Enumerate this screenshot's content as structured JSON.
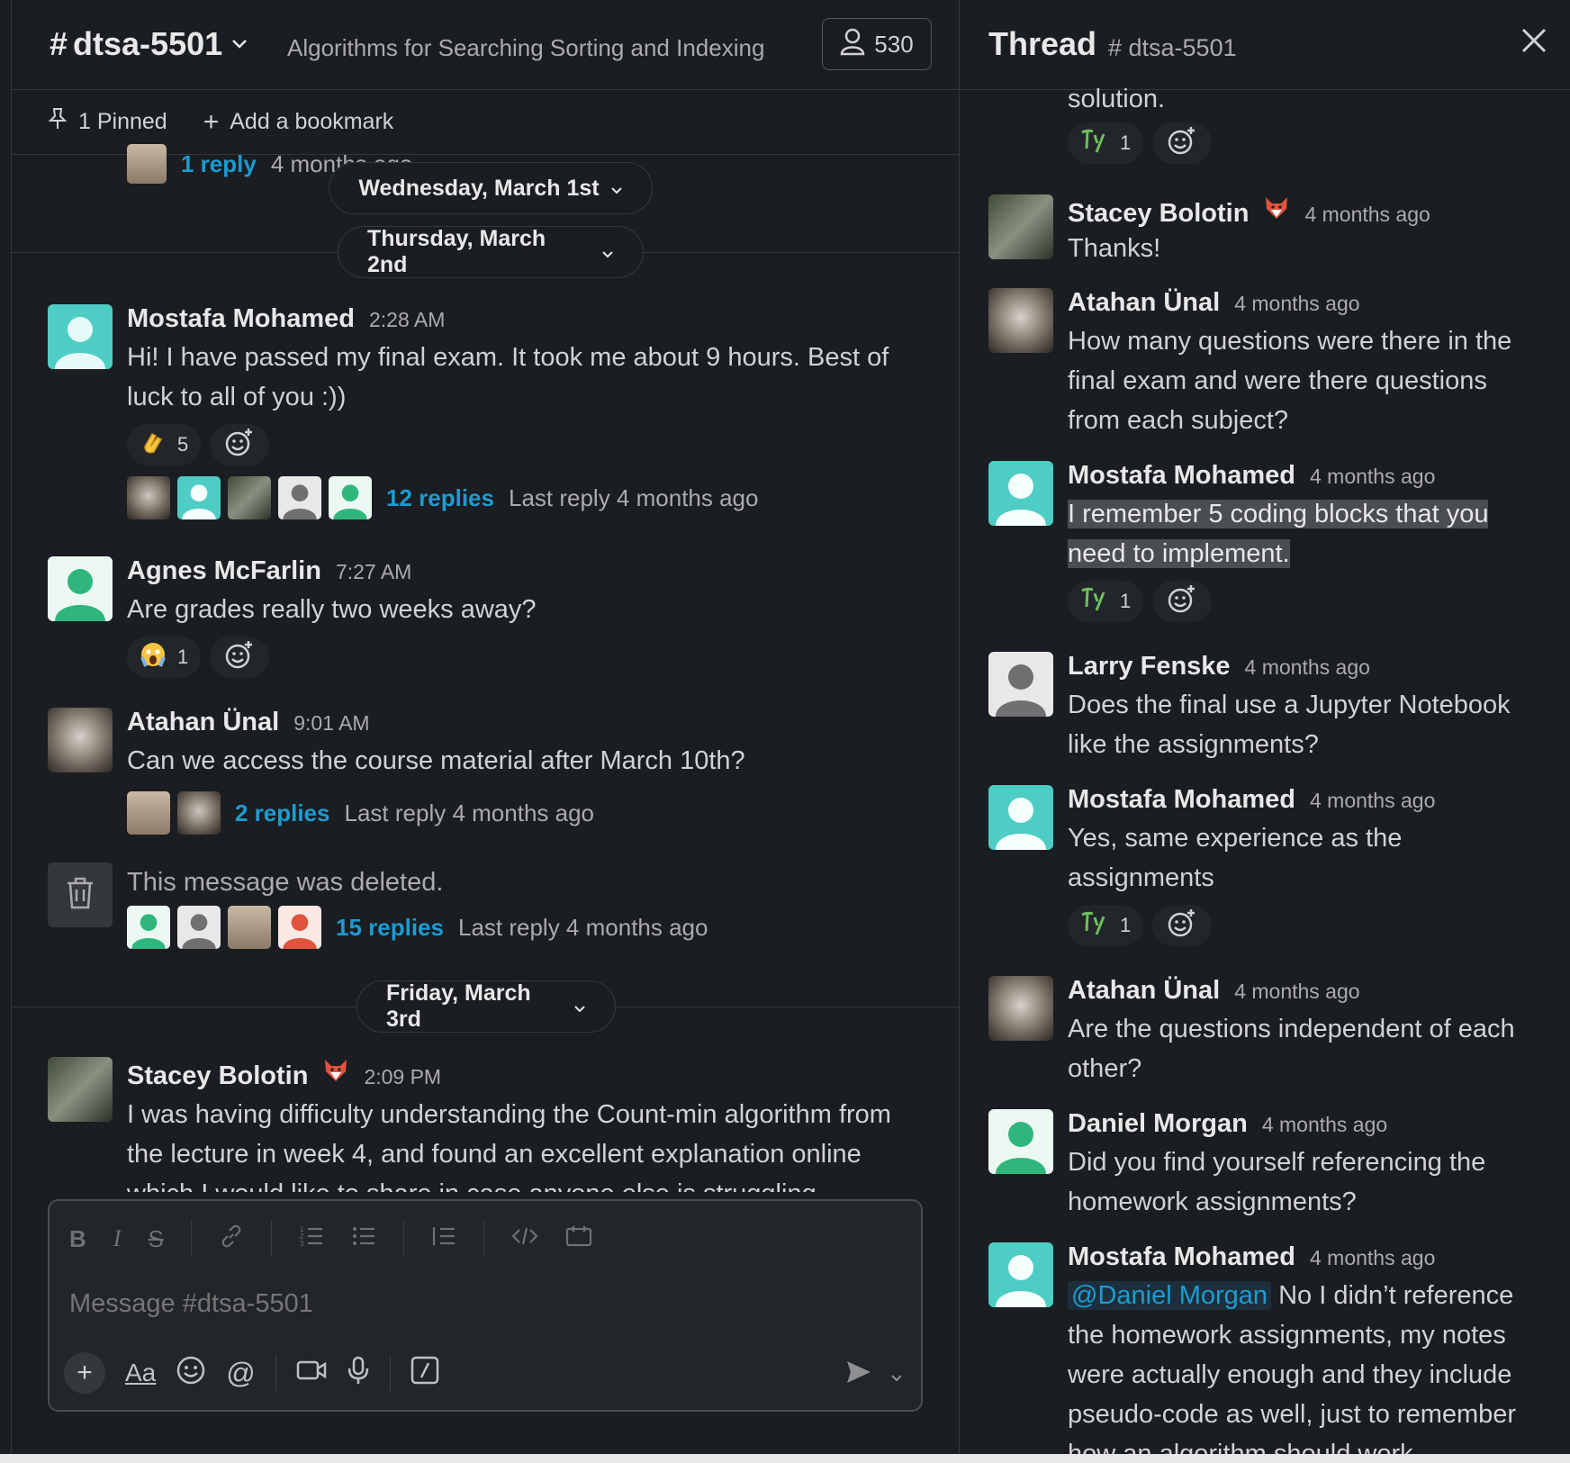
{
  "channel": {
    "hash": "#",
    "name": "dtsa-5501",
    "topic": "Algorithms for Searching Sorting and Indexing",
    "member_count": "530",
    "pinned_label": "1 Pinned",
    "bookmark_label": "Add a bookmark"
  },
  "top_partial": {
    "reply_link": "1 reply",
    "reply_last": "4 months ago"
  },
  "dates": {
    "d1": "Wednesday, March 1st",
    "d2": "Thursday, March 2nd",
    "d3": "Friday, March 3rd"
  },
  "messages": [
    {
      "author": "Mostafa Mohamed",
      "time": "2:28 AM",
      "text": "Hi! I have passed my final exam. It took me about 9 hours. Best of luck to all of you :))",
      "reaction_count": "5",
      "reply_link": "12 replies",
      "reply_last": "Last reply 4 months ago"
    },
    {
      "author": "Agnes McFarlin",
      "time": "7:27 AM",
      "text": "Are grades really two weeks away?",
      "reaction_count": "1"
    },
    {
      "author": "Atahan Ünal",
      "time": "9:01 AM",
      "text": "Can we access the course material after March 10th?",
      "reply_link": "2 replies",
      "reply_last": "Last reply 4 months ago"
    },
    {
      "text": "This message was deleted.",
      "reply_link": "15 replies",
      "reply_last": "Last reply 4 months ago"
    },
    {
      "author": "Stacey Bolotin",
      "time": "2:09 PM",
      "text": "I was having difficulty understanding the Count-min  algorithm from the lecture in week 4, and found an excellent explanation online which I would like to share in case anyone else is struggling"
    }
  ],
  "composer": {
    "placeholder": "Message #dtsa-5501"
  },
  "thread": {
    "title": "Thread",
    "channel": "# dtsa-5501",
    "top_text": "solution.",
    "top_reaction_count": "1",
    "items": [
      {
        "author": "Stacey Bolotin",
        "time": "4 months ago",
        "text": "Thanks!"
      },
      {
        "author": "Atahan Ünal",
        "time": "4 months ago",
        "text": "How many questions were there in the final exam and were there questions from each subject?"
      },
      {
        "author": "Mostafa Mohamed",
        "time": "4 months ago",
        "text": "I remember 5 coding blocks that you need to implement.",
        "reaction_count": "1"
      },
      {
        "author": "Larry Fenske",
        "time": "4 months ago",
        "text": "Does the final use a Jupyter Notebook like the assignments?"
      },
      {
        "author": "Mostafa Mohamed",
        "time": "4 months ago",
        "text": "Yes, same experience as the assignments",
        "reaction_count": "1"
      },
      {
        "author": "Atahan Ünal",
        "time": "4 months ago",
        "text": "Are the questions independent of each other?"
      },
      {
        "author": "Daniel Morgan",
        "time": "4 months ago",
        "text": "Did you find yourself referencing the homework assignments?"
      },
      {
        "author": "Mostafa Mohamed",
        "time": "4 months ago",
        "mention": "@Daniel Morgan",
        "text": " No I didn’t reference the homework assignments, my notes were actually enough and they include pseudo-code as well, just to remember how an algorithm should work"
      }
    ]
  },
  "colors": {
    "teal_avatar": "#4ecdc4",
    "green_avatar": "#2eb67d",
    "link": "#1d9bd1",
    "background": "#1a1d21"
  },
  "icons": [
    "pin-icon",
    "plus-icon",
    "person-icon",
    "chevron-down-icon",
    "close-icon",
    "trash-icon",
    "clap-emoji",
    "scream-emoji",
    "ty-emoji",
    "fox-emoji",
    "add-reaction-icon",
    "send-icon"
  ]
}
